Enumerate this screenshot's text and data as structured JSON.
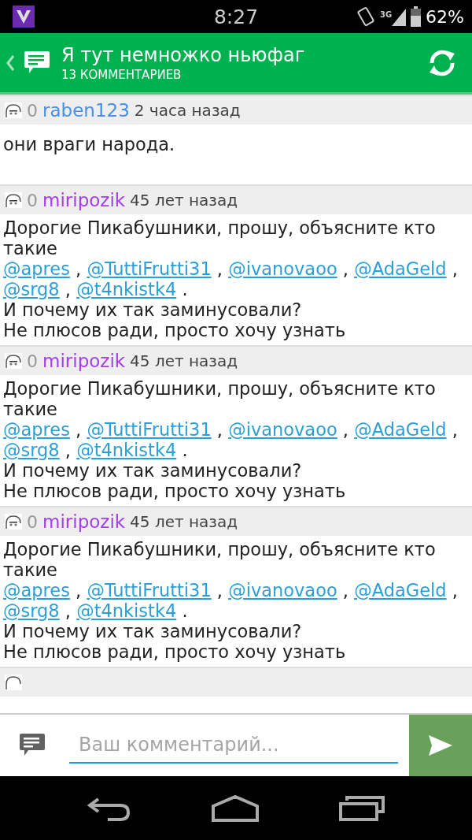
{
  "status_bar": {
    "time": "8:27",
    "network": "3G",
    "battery": "62%"
  },
  "header": {
    "title": "Я тут немножко ньюфаг",
    "subtitle": "13 КОММЕНТАРИЕВ"
  },
  "comments": [
    {
      "rating": "0",
      "author": "raben123",
      "color": "#4a8fe6",
      "time": "2 часа назад",
      "lines": [
        [
          {
            "kind": "text",
            "text": "они враги народа."
          }
        ]
      ]
    },
    {
      "rating": "0",
      "author": "miripozik",
      "color": "#a33ee8",
      "time": "45 лет назад",
      "lines": [
        [
          {
            "kind": "text",
            "text": "Дорогие Пикабушники, прошу, объясните кто такие"
          }
        ],
        [
          {
            "kind": "mention",
            "text": "@apres"
          },
          {
            "kind": "text",
            "text": " , "
          },
          {
            "kind": "mention",
            "text": "@TuttiFrutti31"
          },
          {
            "kind": "text",
            "text": " , "
          },
          {
            "kind": "mention",
            "text": "@ivanovaoo"
          },
          {
            "kind": "text",
            "text": " , "
          },
          {
            "kind": "mention",
            "text": "@AdaGeld"
          },
          {
            "kind": "text",
            "text": " , "
          },
          {
            "kind": "mention",
            "text": "@srg8"
          },
          {
            "kind": "text",
            "text": " , "
          },
          {
            "kind": "mention",
            "text": "@t4nkistk4"
          },
          {
            "kind": "text",
            "text": " ."
          }
        ],
        [
          {
            "kind": "text",
            "text": "И почему их так заминусовали?"
          }
        ],
        [
          {
            "kind": "text",
            "text": "Не плюсов ради, просто хочу узнать"
          }
        ]
      ]
    },
    {
      "rating": "0",
      "author": "miripozik",
      "color": "#a33ee8",
      "time": "45 лет назад",
      "lines": [
        [
          {
            "kind": "text",
            "text": "Дорогие Пикабушники, прошу, объясните кто такие"
          }
        ],
        [
          {
            "kind": "mention",
            "text": "@apres"
          },
          {
            "kind": "text",
            "text": " , "
          },
          {
            "kind": "mention",
            "text": "@TuttiFrutti31"
          },
          {
            "kind": "text",
            "text": " , "
          },
          {
            "kind": "mention",
            "text": "@ivanovaoo"
          },
          {
            "kind": "text",
            "text": " , "
          },
          {
            "kind": "mention",
            "text": "@AdaGeld"
          },
          {
            "kind": "text",
            "text": " , "
          },
          {
            "kind": "mention",
            "text": "@srg8"
          },
          {
            "kind": "text",
            "text": " , "
          },
          {
            "kind": "mention",
            "text": "@t4nkistk4"
          },
          {
            "kind": "text",
            "text": " ."
          }
        ],
        [
          {
            "kind": "text",
            "text": "И почему их так заминусовали?"
          }
        ],
        [
          {
            "kind": "text",
            "text": "Не плюсов ради, просто хочу узнать"
          }
        ]
      ]
    },
    {
      "rating": "0",
      "author": "miripozik",
      "color": "#a33ee8",
      "time": "45 лет назад",
      "lines": [
        [
          {
            "kind": "text",
            "text": "Дорогие Пикабушники, прошу, объясните кто такие"
          }
        ],
        [
          {
            "kind": "mention",
            "text": "@apres"
          },
          {
            "kind": "text",
            "text": " , "
          },
          {
            "kind": "mention",
            "text": "@TuttiFrutti31"
          },
          {
            "kind": "text",
            "text": " , "
          },
          {
            "kind": "mention",
            "text": "@ivanovaoo"
          },
          {
            "kind": "text",
            "text": " , "
          },
          {
            "kind": "mention",
            "text": "@AdaGeld"
          },
          {
            "kind": "text",
            "text": " , "
          },
          {
            "kind": "mention",
            "text": "@srg8"
          },
          {
            "kind": "text",
            "text": " , "
          },
          {
            "kind": "mention",
            "text": "@t4nkistk4"
          },
          {
            "kind": "text",
            "text": " ."
          }
        ],
        [
          {
            "kind": "text",
            "text": "И почему их так заминусовали?"
          }
        ],
        [
          {
            "kind": "text",
            "text": "Не плюсов ради, просто хочу узнать"
          }
        ]
      ]
    }
  ],
  "composer": {
    "placeholder": "Ваш комментарий..."
  }
}
